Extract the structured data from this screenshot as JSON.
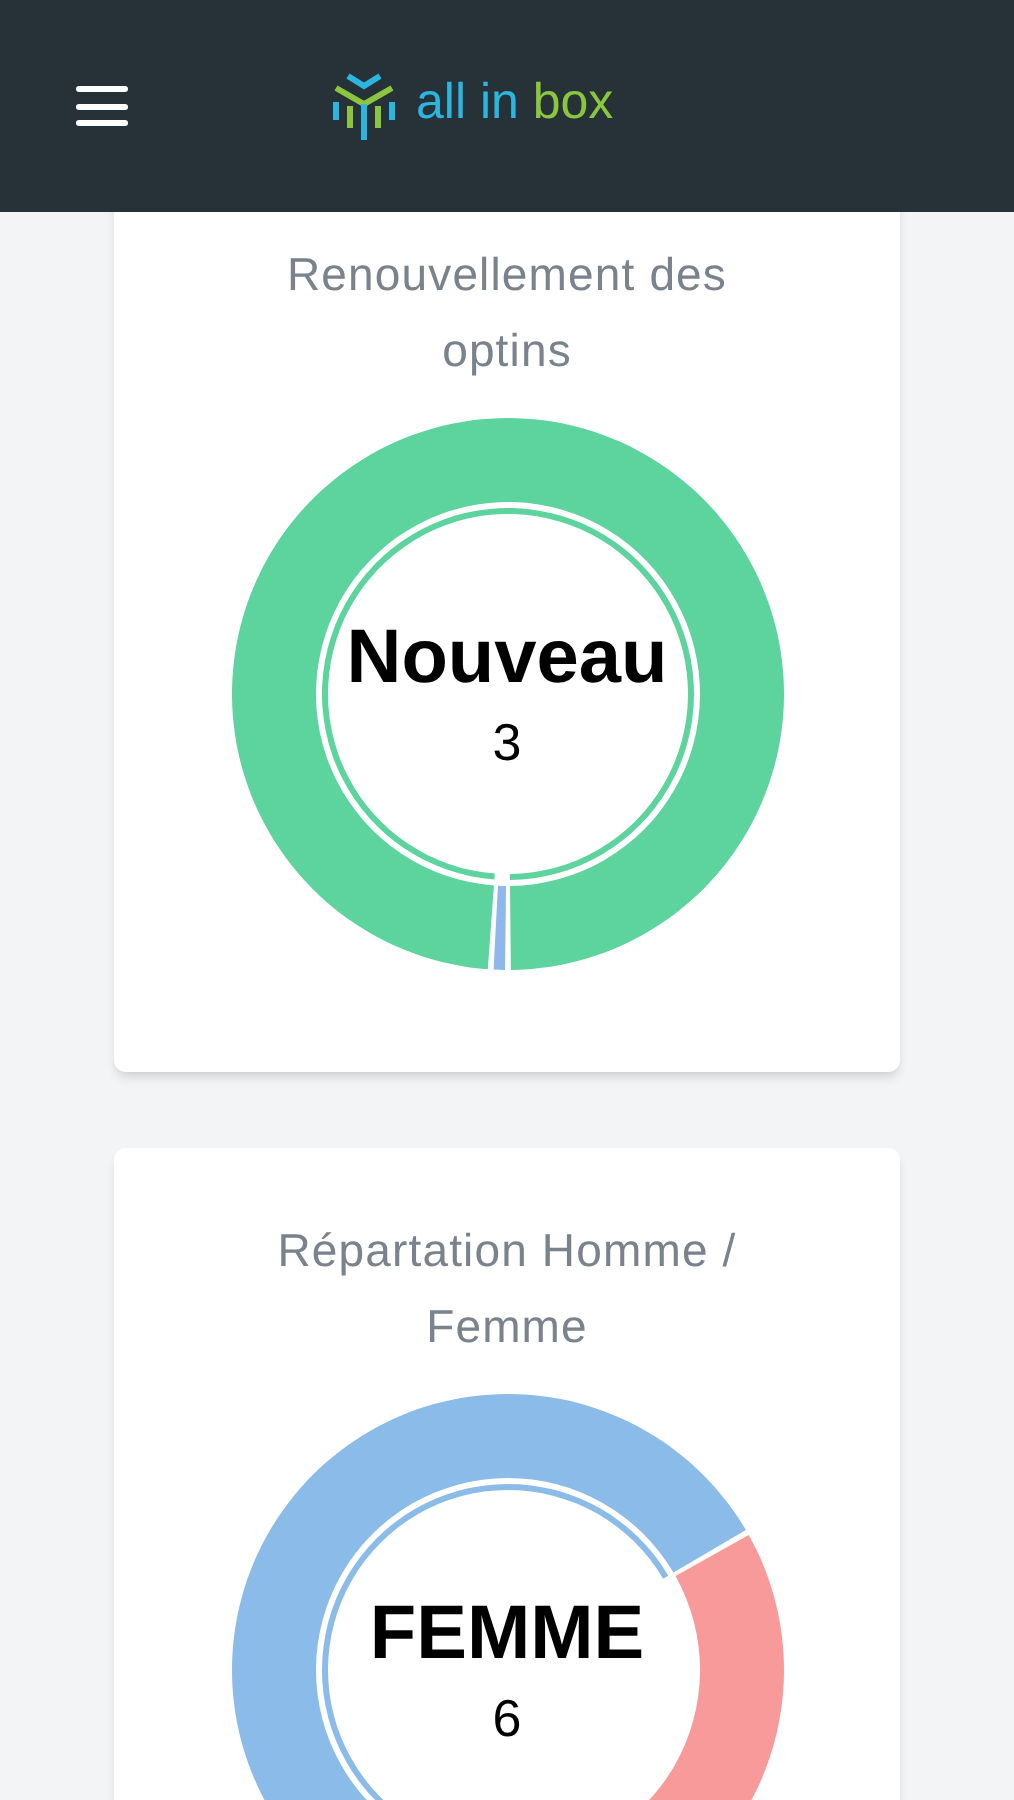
{
  "header": {
    "logo_text_1": "all in",
    "logo_text_2": "box"
  },
  "cards": [
    {
      "title": "Renouvellement des optins",
      "center_label": "Nouveau",
      "center_value": "3",
      "chart_data": {
        "type": "donut",
        "values": [
          1,
          99
        ]
      },
      "segments": [
        {
          "color": "#8fb8ea",
          "selected": false
        },
        {
          "color": "#5dd39e",
          "selected": true
        }
      ]
    },
    {
      "title": "Répartation Homme / Femme",
      "center_label": "FEMME",
      "center_value": "6",
      "chart_data": {
        "type": "donut",
        "values": [
          66.7,
          33.3
        ]
      },
      "segments": [
        {
          "color": "#8bbbe8",
          "selected": true
        },
        {
          "color": "#f89a9a",
          "selected": false
        }
      ]
    }
  ]
}
